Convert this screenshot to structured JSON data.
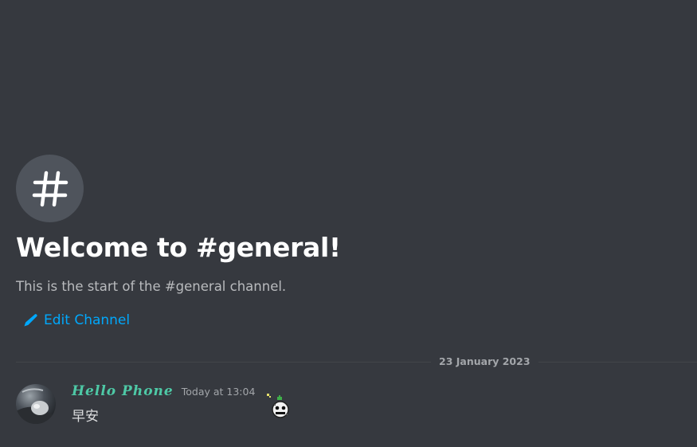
{
  "channel": {
    "icon": "hashtag-icon",
    "welcome_title": "Welcome to #general!",
    "welcome_subtitle": "This is the start of the #general channel.",
    "edit_label": "Edit Channel",
    "edit_icon": "pencil-icon"
  },
  "divider": {
    "date": "23 January 2023"
  },
  "message": {
    "author": "Hello Phone",
    "timestamp": "Today at 13:04",
    "content": "早安",
    "avatar_icon": "avatar-image",
    "decoration_icon": "sparkle-badge-icon"
  },
  "colors": {
    "background": "#36393f",
    "link": "#00a8fc",
    "username": "#4ec9a6",
    "icon_circle": "#4f545c"
  }
}
